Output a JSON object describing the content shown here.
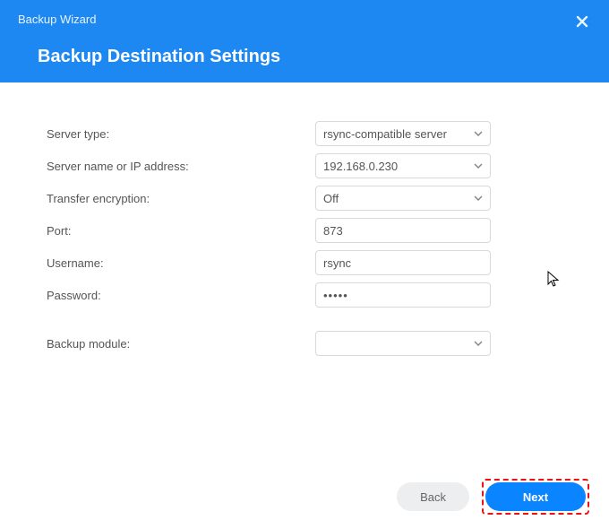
{
  "header": {
    "wizard_title": "Backup Wizard",
    "page_title": "Backup Destination Settings"
  },
  "form": {
    "server_type": {
      "label": "Server type:",
      "value": "rsync-compatible server"
    },
    "server_name": {
      "label": "Server name or IP address:",
      "value": "192.168.0.230"
    },
    "encryption": {
      "label": "Transfer encryption:",
      "value": "Off"
    },
    "port": {
      "label": "Port:",
      "value": "873"
    },
    "username": {
      "label": "Username:",
      "value": "rsync"
    },
    "password": {
      "label": "Password:",
      "value": "•••••"
    },
    "module": {
      "label": "Backup module:",
      "value": ""
    }
  },
  "footer": {
    "back": "Back",
    "next": "Next"
  }
}
